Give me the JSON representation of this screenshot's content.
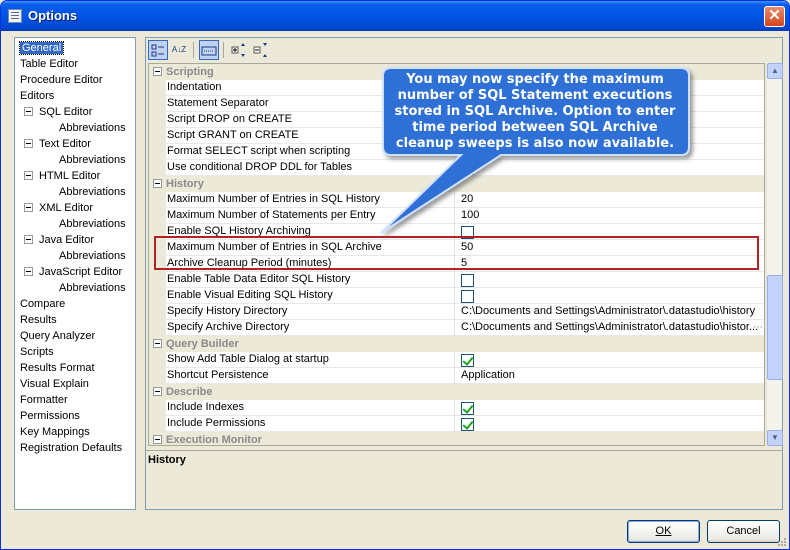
{
  "window": {
    "title": "Options",
    "close_glyph": "✕"
  },
  "tree": [
    {
      "label": "General",
      "indent": 0,
      "selected": true
    },
    {
      "label": "Table Editor",
      "indent": 0
    },
    {
      "label": "Procedure Editor",
      "indent": 0
    },
    {
      "label": "Editors",
      "indent": 0
    },
    {
      "label": "SQL Editor",
      "indent": 1,
      "toggle": true
    },
    {
      "label": "Abbreviations",
      "indent": 2
    },
    {
      "label": "Text Editor",
      "indent": 1,
      "toggle": true
    },
    {
      "label": "Abbreviations",
      "indent": 2
    },
    {
      "label": "HTML Editor",
      "indent": 1,
      "toggle": true
    },
    {
      "label": "Abbreviations",
      "indent": 2
    },
    {
      "label": "XML Editor",
      "indent": 1,
      "toggle": true
    },
    {
      "label": "Abbreviations",
      "indent": 2
    },
    {
      "label": "Java Editor",
      "indent": 1,
      "toggle": true
    },
    {
      "label": "Abbreviations",
      "indent": 2
    },
    {
      "label": "JavaScript Editor",
      "indent": 1,
      "toggle": true
    },
    {
      "label": "Abbreviations",
      "indent": 2
    },
    {
      "label": "Compare",
      "indent": 0
    },
    {
      "label": "Results",
      "indent": 0
    },
    {
      "label": "Query Analyzer",
      "indent": 0
    },
    {
      "label": "Scripts",
      "indent": 0
    },
    {
      "label": "Results Format",
      "indent": 0
    },
    {
      "label": "Visual Explain",
      "indent": 0
    },
    {
      "label": "Formatter",
      "indent": 0
    },
    {
      "label": "Permissions",
      "indent": 0
    },
    {
      "label": "Key Mappings",
      "indent": 0
    },
    {
      "label": "Registration Defaults",
      "indent": 0
    }
  ],
  "toolbar": {
    "categorized_icon": "categorized-icon",
    "alpha_sort_glyph": "A↓Z",
    "description_icon": "description-icon",
    "expand_icon": "expand-all-icon",
    "collapse_icon": "collapse-all-icon"
  },
  "properties": [
    {
      "type": "category",
      "label": "Scripting"
    },
    {
      "key": "Indentation",
      "value": ""
    },
    {
      "key": "Statement Separator",
      "value": ""
    },
    {
      "key": "Script DROP on CREATE",
      "value": ""
    },
    {
      "key": "Script GRANT on CREATE",
      "value": ""
    },
    {
      "key": "Format SELECT script when scripting",
      "checkbox": false
    },
    {
      "key": "Use conditional DROP DDL for Tables",
      "checkbox": false
    },
    {
      "type": "category",
      "label": "History"
    },
    {
      "key": "Maximum Number of Entries in SQL History",
      "value": "20"
    },
    {
      "key": "Maximum Number of Statements per Entry",
      "value": "100"
    },
    {
      "key": "Enable SQL History Archiving",
      "checkbox": false
    },
    {
      "key": "Maximum Number of Entries in SQL Archive",
      "value": "50"
    },
    {
      "key": "Archive Cleanup Period (minutes)",
      "value": "5"
    },
    {
      "key": "Enable Table Data Editor SQL History",
      "checkbox": false
    },
    {
      "key": "Enable Visual Editing SQL History",
      "checkbox": false
    },
    {
      "key": "Specify History Directory",
      "value": "C:\\Documents and Settings\\Administrator\\.datastudio\\history"
    },
    {
      "key": "Specify Archive Directory",
      "value": "C:\\Documents and Settings\\Administrator\\.datastudio\\histor...",
      "ellipsis_btn": "⋯"
    },
    {
      "type": "category",
      "label": "Query Builder"
    },
    {
      "key": "Show Add Table Dialog at startup",
      "checkbox": true
    },
    {
      "key": "Shortcut Persistence",
      "value": "Application"
    },
    {
      "type": "category",
      "label": "Describe"
    },
    {
      "key": "Include Indexes",
      "checkbox": true
    },
    {
      "key": "Include Permissions",
      "checkbox": true
    },
    {
      "type": "category",
      "label": "Execution Monitor"
    }
  ],
  "scrollbar": {
    "up_glyph": "▲",
    "down_glyph": "▼"
  },
  "description": {
    "title": "History"
  },
  "callout": {
    "text": "You may now specify the maximum number of SQL Statement executions stored in SQL Archive. Option to enter time period between SQL Archive cleanup sweeps is also now available.",
    "fill": "#2f6fd6"
  },
  "buttons": {
    "ok": "OK",
    "cancel": "Cancel"
  },
  "colors": {
    "titlebar": "#0055e5",
    "selection": "#316ac5",
    "highlight_border": "#b22222"
  }
}
